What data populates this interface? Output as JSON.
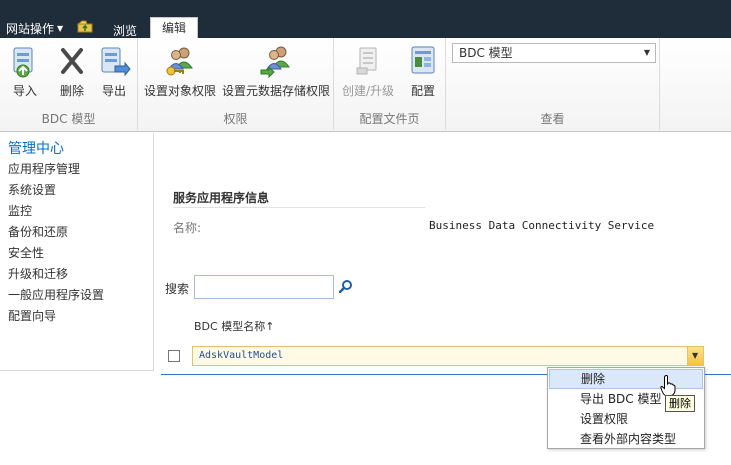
{
  "topbar": {
    "site_actions": "网站操作",
    "tabs": {
      "browse": "浏览",
      "edit": "编辑"
    }
  },
  "ribbon": {
    "groups": {
      "bdc_model": {
        "label": "BDC 模型",
        "buttons": {
          "import": "导入",
          "delete": "删除",
          "export": "导出"
        }
      },
      "permissions": {
        "label": "权限",
        "buttons": {
          "set_object_permissions": "设置对象权限",
          "set_metadata_store_permissions": "设置元数据存储权限"
        }
      },
      "profile_pages": {
        "label": "配置文件页",
        "buttons": {
          "create_upgrade": "创建/升级",
          "configure": "配置"
        }
      },
      "view": {
        "label": "查看",
        "select_value": "BDC 模型"
      }
    }
  },
  "leftnav": {
    "heading": "管理中心",
    "items": [
      "应用程序管理",
      "系统设置",
      "监控",
      "备份和还原",
      "安全性",
      "升级和迁移",
      "一般应用程序设置",
      "配置向导"
    ]
  },
  "main": {
    "section_title": "服务应用程序信息",
    "name_label": "名称:",
    "name_value": "Business Data Connectivity Service",
    "search_label": "搜索",
    "search_value": "",
    "column_header": "BDC 模型名称↑",
    "rows": [
      {
        "name": "AdskVaultModel"
      }
    ]
  },
  "context_menu": {
    "items": [
      "删除",
      "导出 BDC 模型",
      "设置权限",
      "查看外部内容类型"
    ],
    "hovered_index": 0
  },
  "tooltip": "删除",
  "colors": {
    "topbar": "#1f2c3a",
    "link": "#0072c6",
    "row_highlight": "#fffae6",
    "menu_hover": "#dbe8f7"
  }
}
